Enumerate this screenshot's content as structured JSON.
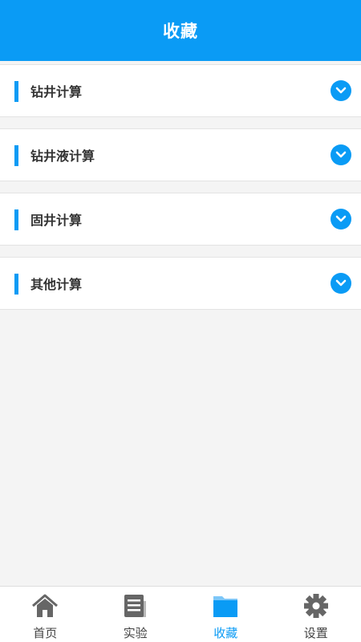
{
  "header": {
    "title": "收藏"
  },
  "groups": [
    {
      "label": "钻井计算"
    },
    {
      "label": "钻井液计算"
    },
    {
      "label": "固井计算"
    },
    {
      "label": "其他计算"
    }
  ],
  "tabs": [
    {
      "label": "首页",
      "icon": "home-icon"
    },
    {
      "label": "实验",
      "icon": "document-list-icon"
    },
    {
      "label": "收藏",
      "icon": "folder-icon",
      "active": true
    },
    {
      "label": "设置",
      "icon": "gear-icon"
    }
  ],
  "colors": {
    "accent": "#0a9bf5",
    "background": "#f4f4f4",
    "icon_gray": "#666666"
  }
}
